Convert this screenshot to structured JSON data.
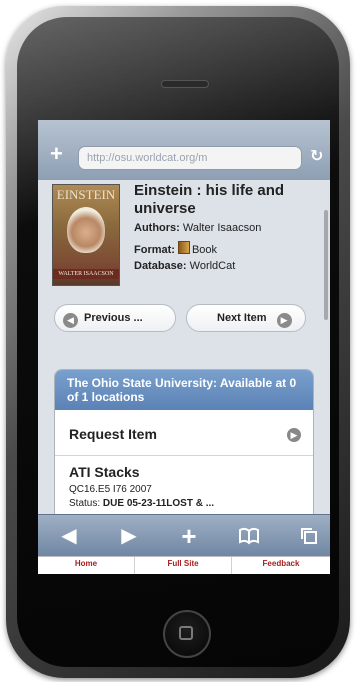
{
  "browser": {
    "url": "http://osu.worldcat.org/m"
  },
  "book": {
    "cover": {
      "title_text": "EINSTEIN",
      "author_text": "WALTER ISAACSON"
    },
    "title": "Einstein : his life and universe",
    "authors_label": "Authors:",
    "authors": "Walter Isaacson",
    "format_label": "Format:",
    "format": "Book",
    "database_label": "Database:",
    "database": "WorldCat"
  },
  "nav": {
    "previous_label": "Previous ...",
    "next_label": "Next Item"
  },
  "availability": {
    "header": "The Ohio State University: Available at 0 of 1 locations",
    "request_label": "Request Item",
    "location": {
      "name": "ATI Stacks",
      "call_number": "QC16.E5 I76 2007",
      "status_label": "Status:",
      "status": "DUE 05-23-11LOST & ..."
    }
  },
  "toolbar": {
    "icons": [
      "back-icon",
      "forward-icon",
      "add-icon",
      "bookmarks-icon",
      "pages-icon"
    ]
  },
  "footer": {
    "items": [
      "Home",
      "Full Site",
      "Feedback"
    ]
  },
  "colors": {
    "accent_blue": "#5b82b5",
    "footer_link": "#a82020"
  }
}
